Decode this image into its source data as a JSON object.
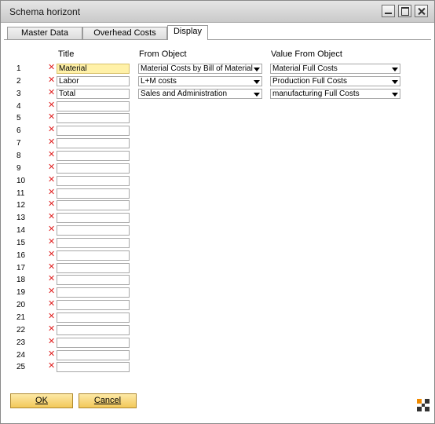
{
  "window": {
    "title": "Schema horizont"
  },
  "tabs": [
    {
      "label": "Master Data"
    },
    {
      "label": "Overhead Costs"
    },
    {
      "label": "Display"
    }
  ],
  "columns": {
    "title": "Title",
    "from_object": "From Object",
    "value_from_object": "Value From Object"
  },
  "rows": [
    {
      "num": "1",
      "title": "Material",
      "from": "Material Costs by Bill of Material",
      "value": "Material Full Costs"
    },
    {
      "num": "2",
      "title": "Labor",
      "from": "L+M costs",
      "value": "Production Full Costs"
    },
    {
      "num": "3",
      "title": "Total",
      "from": "Sales and Administration",
      "value": "manufacturing Full Costs"
    },
    {
      "num": "4",
      "title": ""
    },
    {
      "num": "5",
      "title": ""
    },
    {
      "num": "6",
      "title": ""
    },
    {
      "num": "7",
      "title": ""
    },
    {
      "num": "8",
      "title": ""
    },
    {
      "num": "9",
      "title": ""
    },
    {
      "num": "10",
      "title": ""
    },
    {
      "num": "11",
      "title": ""
    },
    {
      "num": "12",
      "title": ""
    },
    {
      "num": "13",
      "title": ""
    },
    {
      "num": "14",
      "title": ""
    },
    {
      "num": "15",
      "title": ""
    },
    {
      "num": "16",
      "title": ""
    },
    {
      "num": "17",
      "title": ""
    },
    {
      "num": "18",
      "title": ""
    },
    {
      "num": "19",
      "title": ""
    },
    {
      "num": "20",
      "title": ""
    },
    {
      "num": "21",
      "title": ""
    },
    {
      "num": "22",
      "title": ""
    },
    {
      "num": "23",
      "title": ""
    },
    {
      "num": "24",
      "title": ""
    },
    {
      "num": "25",
      "title": ""
    }
  ],
  "delete_glyph": "✕",
  "buttons": {
    "ok": "OK",
    "cancel": "Cancel"
  },
  "colors": {
    "selected_cell": "#fff1a8",
    "delete_icon": "#e02020",
    "button": "#f2c85a"
  }
}
